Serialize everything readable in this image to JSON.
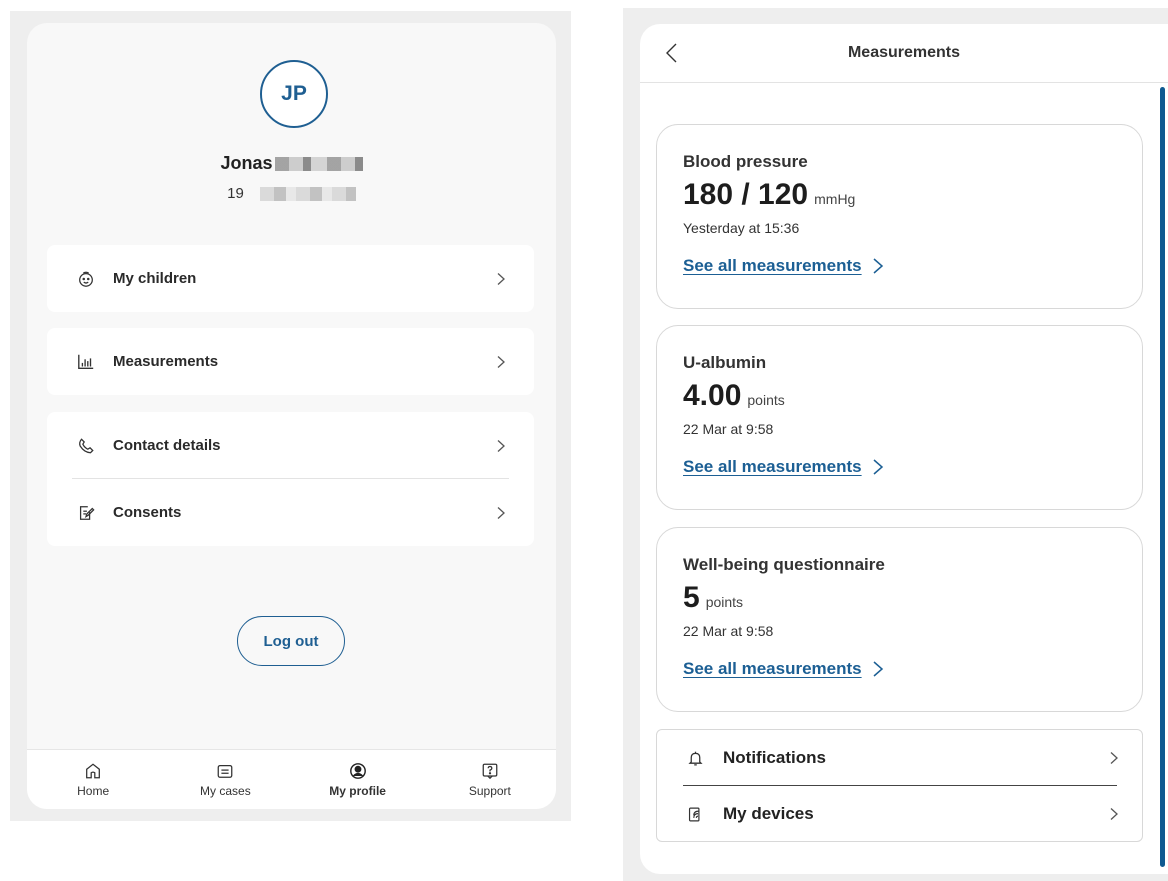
{
  "profile": {
    "initials": "JP",
    "name": "Jonas",
    "id_prefix": "19",
    "menu": [
      {
        "label": "My children",
        "icon": "child-face-icon"
      },
      {
        "label": "Measurements",
        "icon": "bar-chart-icon"
      },
      {
        "label": "Contact details",
        "icon": "phone-icon"
      },
      {
        "label": "Consents",
        "icon": "document-edit-icon"
      }
    ],
    "logout_label": "Log out"
  },
  "bottom_nav": [
    {
      "label": "Home",
      "icon": "home-icon",
      "active": false
    },
    {
      "label": "My cases",
      "icon": "folder-icon",
      "active": false
    },
    {
      "label": "My profile",
      "icon": "profile-icon",
      "active": true
    },
    {
      "label": "Support",
      "icon": "help-icon",
      "active": false
    }
  ],
  "measurements_screen": {
    "title": "Measurements",
    "cards": [
      {
        "title": "Blood pressure",
        "value": "180 / 120",
        "unit": "mmHg",
        "time": "Yesterday at 15:36",
        "link": "See all measurements"
      },
      {
        "title": "U-albumin",
        "value": "4.00",
        "unit": "points",
        "time": "22 Mar at 9:58",
        "link": "See all measurements"
      },
      {
        "title": "Well-being questionnaire",
        "value": "5",
        "unit": "points",
        "time": "22 Mar at 9:58",
        "link": "See all measurements"
      }
    ],
    "options": [
      {
        "label": "Notifications",
        "icon": "bell-icon"
      },
      {
        "label": "My devices",
        "icon": "device-icon"
      }
    ]
  },
  "colors": {
    "brand_blue": "#1f5f92",
    "link_blue": "#1c5f94",
    "scroll_bar": "#0f5a91"
  }
}
